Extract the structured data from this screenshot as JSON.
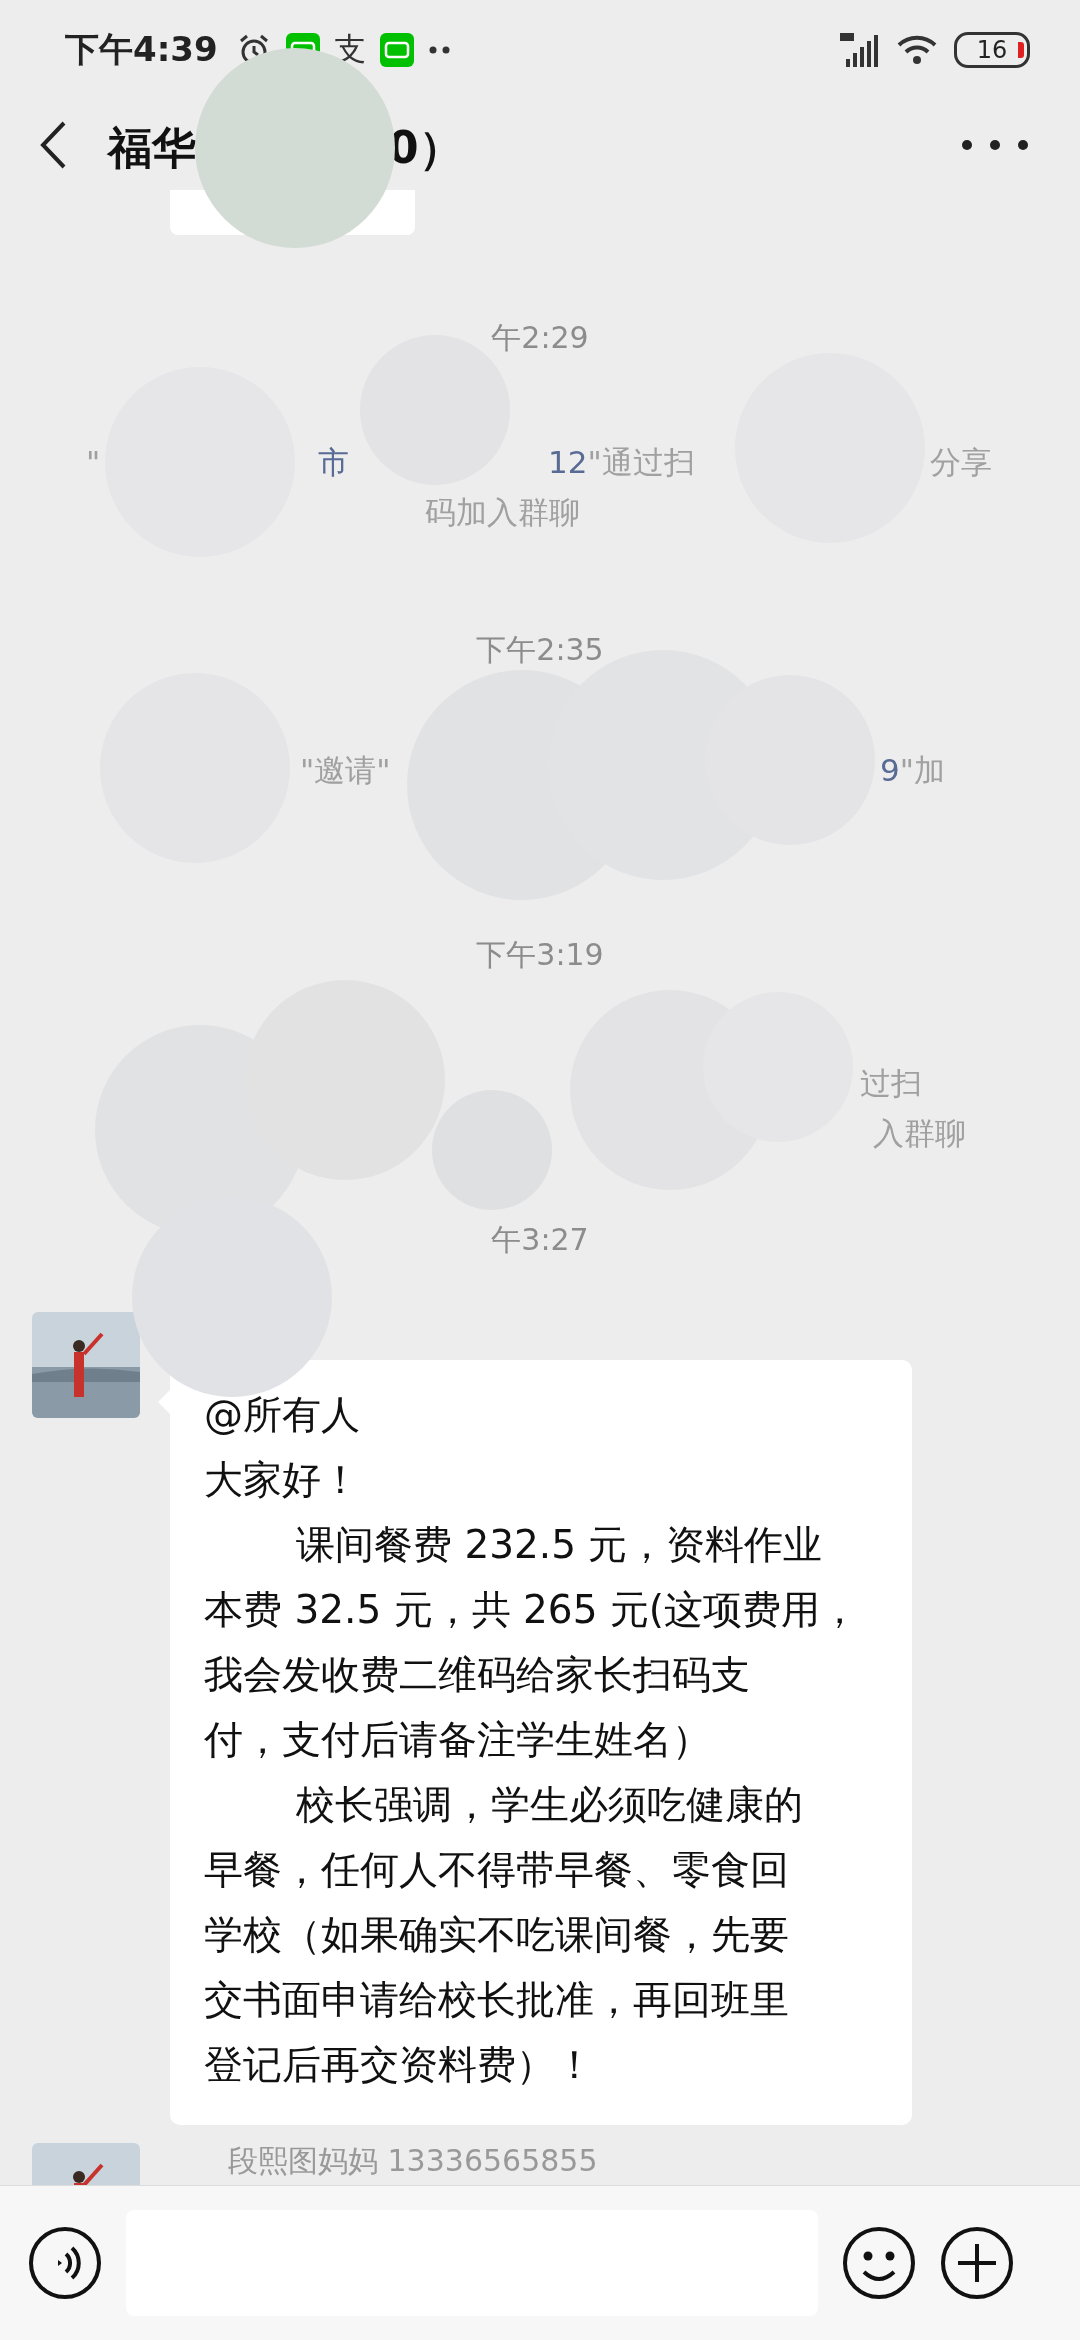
{
  "status_bar": {
    "time": "下午4:39",
    "notifications": [
      {
        "kind": "alarm"
      },
      {
        "kind": "app"
      },
      {
        "kind": "glyph",
        "text": "支"
      },
      {
        "kind": "app"
      },
      {
        "kind": "more"
      }
    ],
    "battery": "16"
  },
  "nav": {
    "title_fragments": [
      "福华",
      "0）"
    ]
  },
  "chat": {
    "items": [
      {
        "kind": "stub"
      },
      {
        "kind": "time",
        "text": "午2:29"
      },
      {
        "kind": "system",
        "lines": [
          {
            "groups": [
              [
                {
                  "text": "\"",
                  "kind": "plain"
                }
              ],
              [
                {
                  "text": "市",
                  "kind": "link"
                }
              ],
              [
                {
                  "text": "12",
                  "kind": "link"
                },
                {
                  "text": "\"通过扫",
                  "kind": "plain"
                }
              ],
              [
                {
                  "text": "分享",
                  "kind": "plain"
                }
              ]
            ]
          },
          {
            "groups": [
              [
                {
                  "text": "码加入群聊",
                  "kind": "plain"
                }
              ]
            ]
          }
        ]
      },
      {
        "kind": "time",
        "text": "下午2:35"
      },
      {
        "kind": "system",
        "lines": [
          {
            "groups": [
              [
                {
                  "text": "\"邀请\"",
                  "kind": "plain"
                }
              ],
              [
                {
                  "text": "9",
                  "kind": "link"
                },
                {
                  "text": "\"加",
                  "kind": "plain"
                }
              ]
            ]
          }
        ]
      },
      {
        "kind": "time",
        "text": "下午3:19"
      },
      {
        "kind": "system",
        "lines": [
          {
            "groups": [
              [
                {
                  "text": "过扫",
                  "kind": "plain"
                }
              ]
            ]
          },
          {
            "groups": [
              [
                {
                  "text": "入群聊",
                  "kind": "plain"
                }
              ]
            ]
          }
        ]
      },
      {
        "kind": "time",
        "text": "午3:27"
      },
      {
        "kind": "message",
        "paragraphs": [
          {
            "indent": false,
            "lines": [
              "@所有人"
            ]
          },
          {
            "indent": false,
            "lines": [
              "大家好！"
            ]
          },
          {
            "indent": true,
            "lines": [
              "课间餐费 232.5 元，资料作业",
              "本费 32.5 元，共 265 元(这项费用，",
              "我会发收费二维码给家长扫码支",
              "付，支付后请备注学生姓名）"
            ]
          },
          {
            "indent": true,
            "lines": [
              "校长强调，学生必须吃健康的",
              "早餐，任何人不得带早餐、零食回",
              "学校（如果确实不吃课间餐，先要",
              "交书面申请给校长批准，再回班里",
              "登记后再交资料费）！"
            ]
          }
        ]
      },
      {
        "kind": "sender",
        "name": "段熙图妈妈 13336565855"
      }
    ]
  }
}
